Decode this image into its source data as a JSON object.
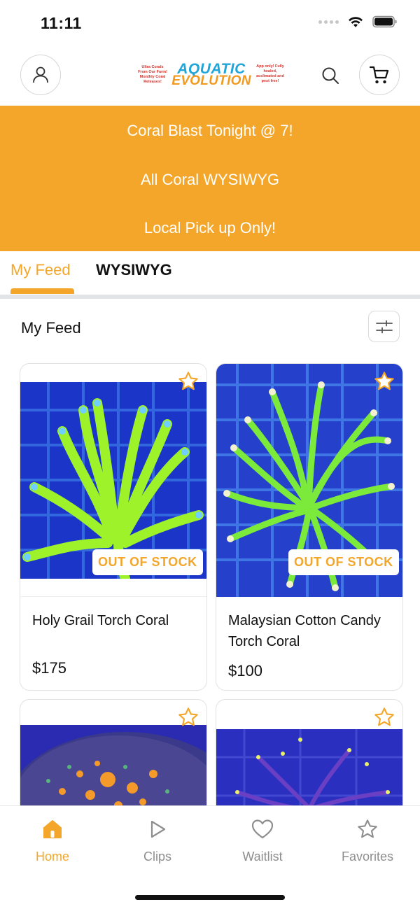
{
  "status_bar": {
    "time": "11:11"
  },
  "header": {
    "logo": {
      "line1": "AQUATIC",
      "line2": "EVOLUTION",
      "left_tagline": "Ultra Corals From Our Farm! Monthly Coral Releases!",
      "right_tagline": "App only! Fully healed, acclimated and pest free!"
    }
  },
  "banner": {
    "lines": [
      "Coral Blast Tonight @ 7!",
      "All Coral WYSIWYG",
      "Local Pick up Only!"
    ],
    "color": "#f3a629"
  },
  "tabs": [
    {
      "label": "My Feed",
      "active": true
    },
    {
      "label": "WYSIWYG",
      "active": false
    }
  ],
  "feed": {
    "title": "My Feed",
    "products": [
      {
        "name": "Holy Grail Torch Coral",
        "price": "$175",
        "badge": "OUT OF STOCK",
        "favorite_icon": "star-outline-icon"
      },
      {
        "name": "Malaysian Cotton Candy Torch Coral",
        "price": "$100",
        "badge": "OUT OF STOCK",
        "favorite_icon": "star-outline-icon"
      },
      {
        "name": "",
        "price": "",
        "badge": "",
        "favorite_icon": "star-outline-icon"
      },
      {
        "name": "",
        "price": "",
        "badge": "",
        "favorite_icon": "star-outline-icon"
      }
    ]
  },
  "bottom_nav": [
    {
      "label": "Home",
      "icon": "home-icon",
      "active": true
    },
    {
      "label": "Clips",
      "icon": "play-icon",
      "active": false
    },
    {
      "label": "Waitlist",
      "icon": "heart-icon",
      "active": false
    },
    {
      "label": "Favorites",
      "icon": "star-icon",
      "active": false
    }
  ],
  "colors": {
    "accent": "#f3a629",
    "logo_blue": "#1fa5d8",
    "logo_red": "#d8322b"
  }
}
